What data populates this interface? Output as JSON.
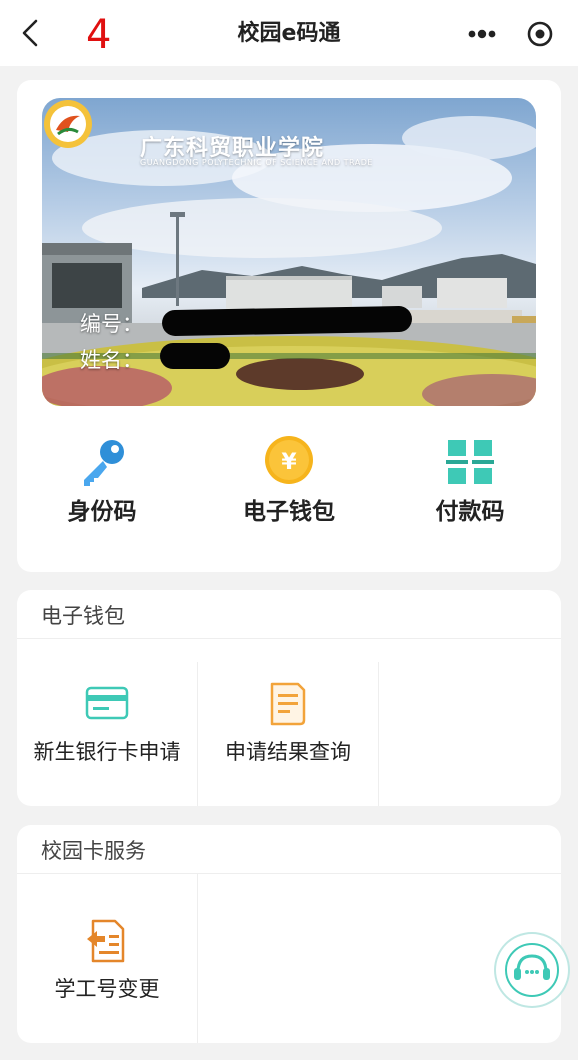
{
  "header": {
    "title": "校园e码通",
    "annotation": "4"
  },
  "card": {
    "school_cn": "广东科贸职业学院",
    "school_en": "GUANGDONG POLYTECHNIC OF SCIENCE AND TRADE",
    "number_label": "编号：",
    "name_label": "姓名："
  },
  "quick_actions": [
    {
      "label": "身份码",
      "icon": "key-icon"
    },
    {
      "label": "电子钱包",
      "icon": "yuan-coin-icon"
    },
    {
      "label": "付款码",
      "icon": "pay-code-icon"
    }
  ],
  "wallet_section": {
    "title": "电子钱包",
    "items": [
      {
        "label": "新生银行卡申请",
        "icon": "bank-card-icon"
      },
      {
        "label": "申请结果查询",
        "icon": "document-icon"
      }
    ]
  },
  "campus_section": {
    "title": "校园卡服务",
    "items": [
      {
        "label": "学工号变更",
        "icon": "id-change-icon"
      }
    ]
  },
  "colors": {
    "teal": "#3ec9b6",
    "orange": "#f2a33a",
    "blue": "#2f8fd8",
    "coin": "#f6b41c"
  }
}
